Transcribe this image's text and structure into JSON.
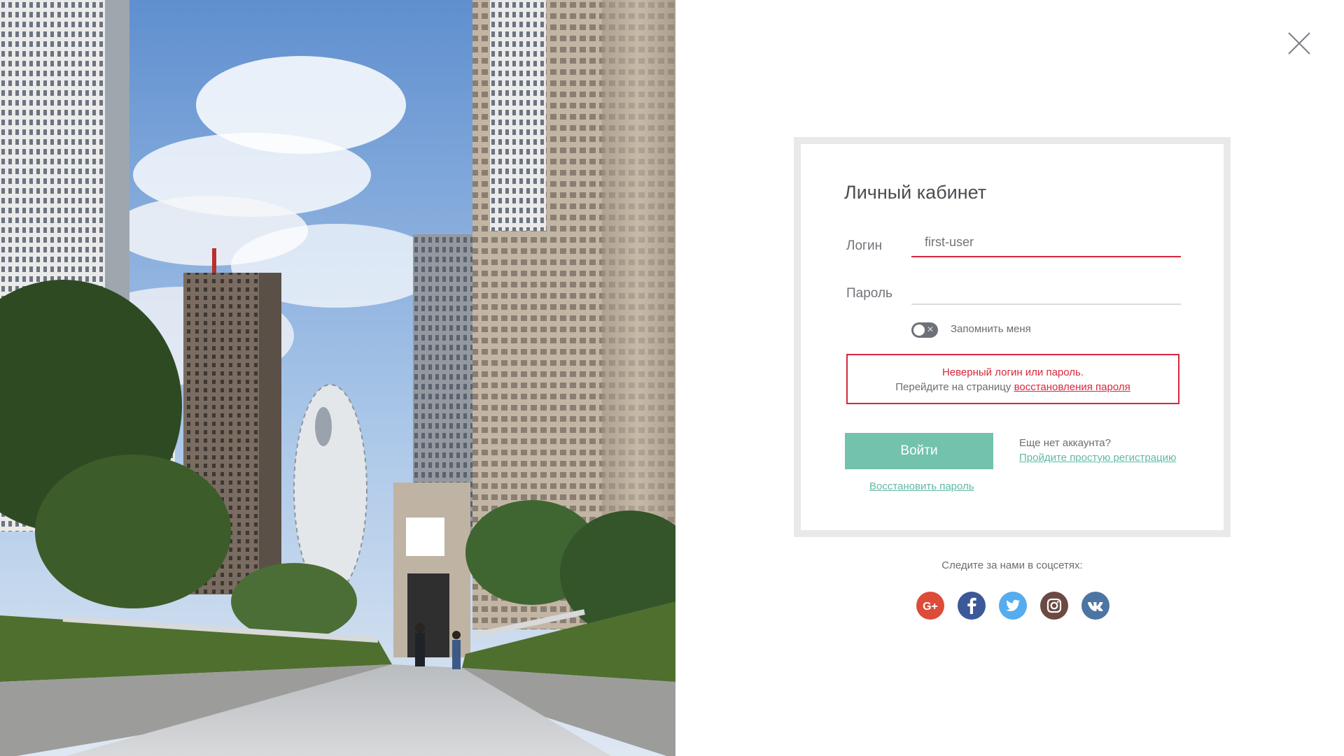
{
  "page": {
    "close_icon": "close-icon",
    "photo_description_icon": "city-photo"
  },
  "login_form": {
    "title": "Личный кабинет",
    "login": {
      "label": "Логин",
      "value": "first-user",
      "placeholder": ""
    },
    "password": {
      "label": "Пароль",
      "value": "",
      "placeholder": ""
    },
    "remember_me": {
      "label": "Запомнить меня",
      "checked": false
    },
    "error": {
      "title": "Неверный логин или пароль.",
      "hint_prefix": "Перейдите на страницу ",
      "hint_link": "восстановления пароля"
    },
    "submit_label": "Войти",
    "no_account_text": "Еще нет аккаунта?",
    "register_link": "Пройдите простую регистрацию",
    "restore_link": "Восстановить пароль"
  },
  "social": {
    "caption": "Следите за нами в соцсетях:",
    "networks": [
      {
        "name": "Google+",
        "icon": "google-plus-icon",
        "color": "#dd4b39"
      },
      {
        "name": "Facebook",
        "icon": "facebook-icon",
        "color": "#3b5998"
      },
      {
        "name": "Twitter",
        "icon": "twitter-icon",
        "color": "#55acee"
      },
      {
        "name": "Instagram",
        "icon": "instagram-icon",
        "color": "#6a4a42"
      },
      {
        "name": "VK",
        "icon": "vk-icon",
        "color": "#4c75a3"
      }
    ]
  },
  "colors": {
    "accent_green": "#72c2ae",
    "link_green": "#5fb9a3",
    "error_red": "#d6283e",
    "text_gray": "#6a6d72"
  }
}
